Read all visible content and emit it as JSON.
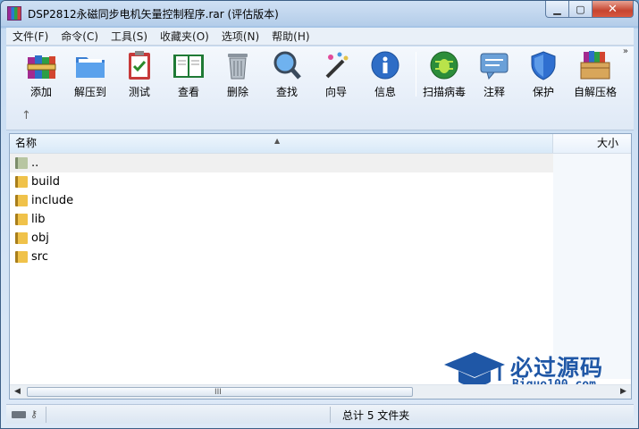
{
  "window": {
    "title": "DSP2812永磁同步电机矢量控制程序.rar (评估版本)"
  },
  "menu": [
    "文件(F)",
    "命令(C)",
    "工具(S)",
    "收藏夹(O)",
    "选项(N)",
    "帮助(H)"
  ],
  "toolbar": {
    "buttons": [
      {
        "label": "添加",
        "icon": "books-add-icon"
      },
      {
        "label": "解压到",
        "icon": "folder-extract-icon"
      },
      {
        "label": "测试",
        "icon": "clipboard-check-icon"
      },
      {
        "label": "查看",
        "icon": "open-book-icon"
      },
      {
        "label": "删除",
        "icon": "trash-can-icon"
      },
      {
        "label": "查找",
        "icon": "magnifier-icon"
      },
      {
        "label": "向导",
        "icon": "magic-wand-icon"
      },
      {
        "label": "信息",
        "icon": "info-icon"
      },
      {
        "label": "扫描病毒",
        "icon": "bug-scan-icon"
      },
      {
        "label": "注释",
        "icon": "comment-icon"
      },
      {
        "label": "保护",
        "icon": "shield-icon"
      },
      {
        "label": "自解压格",
        "icon": "sfx-box-icon"
      }
    ],
    "more": "»",
    "up": "↑"
  },
  "list": {
    "columns": {
      "name": "名称",
      "size": "大小"
    },
    "rows": [
      {
        "name": ".."
      },
      {
        "name": "build"
      },
      {
        "name": "include"
      },
      {
        "name": "lib"
      },
      {
        "name": "obj"
      },
      {
        "name": "src"
      }
    ],
    "scroll": {
      "left": "◀",
      "right": "▶",
      "grip": "III"
    }
  },
  "watermark": {
    "title": "必过源码",
    "subtitle": "Biguo100.com",
    "color": "#1f57a6"
  },
  "status": {
    "summary": "总计 5 文件夹",
    "key": "⚷"
  }
}
